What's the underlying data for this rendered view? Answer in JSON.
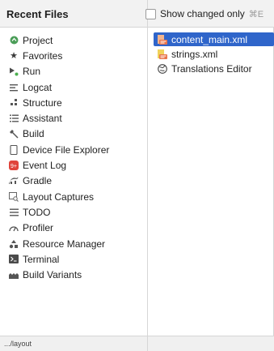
{
  "header": {
    "title": "Recent Files",
    "show_changed_label": "Show changed only",
    "show_changed_shortcut": "⌘E",
    "show_changed_checked": false
  },
  "left_items": [
    {
      "label": "Project",
      "icon": "project-icon"
    },
    {
      "label": "Favorites",
      "icon": "star-icon"
    },
    {
      "label": "Run",
      "icon": "run-icon"
    },
    {
      "label": "Logcat",
      "icon": "logcat-icon"
    },
    {
      "label": "Structure",
      "icon": "structure-icon"
    },
    {
      "label": "Assistant",
      "icon": "assistant-icon"
    },
    {
      "label": "Build",
      "icon": "hammer-icon"
    },
    {
      "label": "Device File Explorer",
      "icon": "device-icon"
    },
    {
      "label": "Event Log",
      "icon": "event-log-icon"
    },
    {
      "label": "Gradle",
      "icon": "gradle-icon"
    },
    {
      "label": "Layout Captures",
      "icon": "layout-captures-icon"
    },
    {
      "label": "TODO",
      "icon": "todo-icon"
    },
    {
      "label": "Profiler",
      "icon": "profiler-icon"
    },
    {
      "label": "Resource Manager",
      "icon": "resource-manager-icon"
    },
    {
      "label": "Terminal",
      "icon": "terminal-icon"
    },
    {
      "label": "Build Variants",
      "icon": "build-variants-icon"
    }
  ],
  "right_items": [
    {
      "label": "content_main.xml",
      "icon": "xml-layout-file-icon",
      "selected": true
    },
    {
      "label": "strings.xml",
      "icon": "xml-values-file-icon",
      "selected": false
    },
    {
      "label": "Translations Editor",
      "icon": "globe-icon",
      "selected": false
    }
  ],
  "status": {
    "path": ".../layout"
  },
  "colors": {
    "selection": "#2f65ca",
    "event_log_badge": "#e0443b",
    "xml_file_icon": "#e8744a",
    "project_icon": "#4a9d57"
  }
}
